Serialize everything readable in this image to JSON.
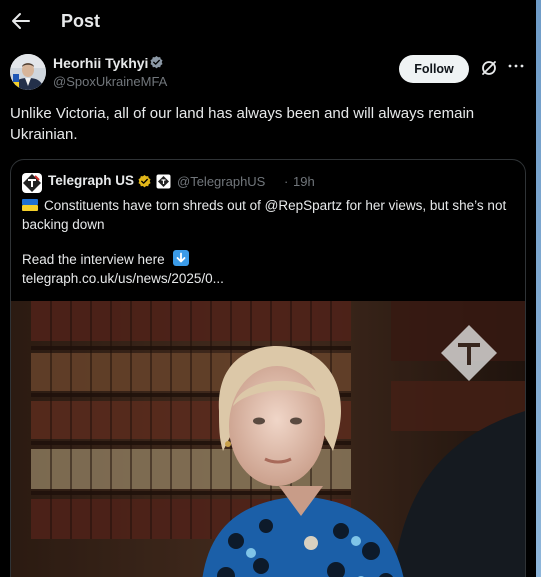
{
  "header": {
    "title": "Post"
  },
  "post": {
    "author_name": "Heorhii Tykhyi",
    "author_handle": "@SpoxUkraineMFA",
    "follow_label": "Follow",
    "text": "Unlike Victoria, all of our land has always been and will always remain Ukrainian."
  },
  "quote": {
    "name": "Telegraph US",
    "handle": "@TelegraphUS",
    "separator": "·",
    "time": "19h",
    "body": "Constituents have torn shreds out of @RepSpartz for her views, but she’s not backing down",
    "read_line": "Read the interview here",
    "link": "telegraph.co.uk/us/news/2025/0..."
  },
  "colors": {
    "background": "#000000",
    "text": "#e7e9ea",
    "muted": "#71767b",
    "verified_blue": "#1d9bf0",
    "gold": "#e2b719",
    "follow_bg": "#eff3f4"
  },
  "icons": {
    "back": "arrow-left-icon",
    "verified": "verified-badge-icon",
    "grok": "grok-icon",
    "more": "more-icon",
    "flag": "ukraine-flag-icon",
    "arrow": "arrow-down-icon"
  }
}
